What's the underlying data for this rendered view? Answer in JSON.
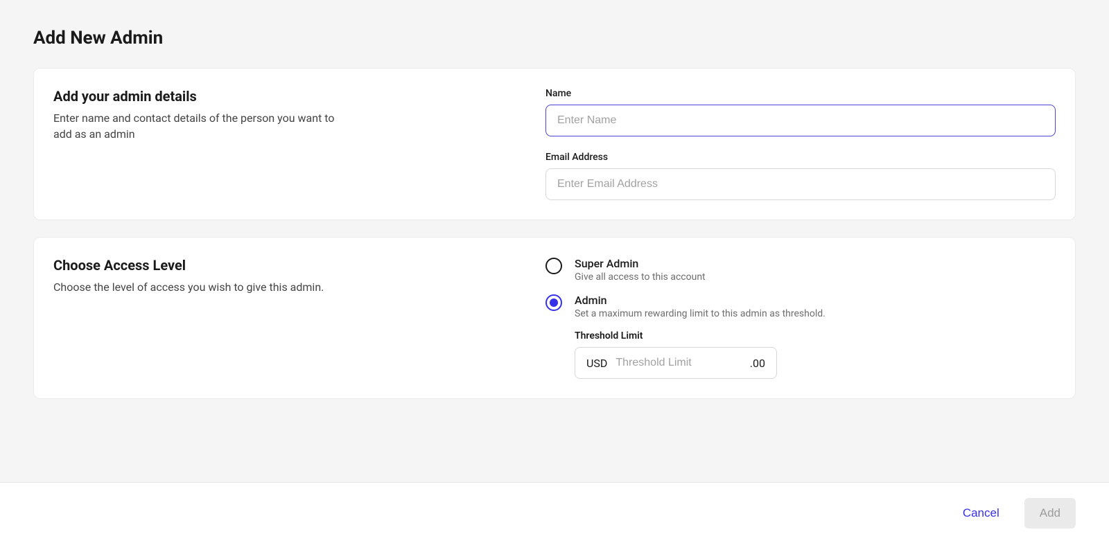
{
  "page": {
    "title": "Add New Admin"
  },
  "details": {
    "heading": "Add your admin details",
    "description": "Enter name and contact details of the person you want to add as an admin",
    "name_label": "Name",
    "name_placeholder": "Enter Name",
    "name_value": "",
    "email_label": "Email Address",
    "email_placeholder": "Enter Email Address",
    "email_value": ""
  },
  "access": {
    "heading": "Choose Access Level",
    "description": "Choose the level of access you wish to give this admin.",
    "options": [
      {
        "title": "Super Admin",
        "desc": "Give all access to this account",
        "selected": false
      },
      {
        "title": "Admin",
        "desc": "Set a maximum rewarding limit to this admin as threshold.",
        "selected": true
      }
    ],
    "threshold": {
      "label": "Threshold Limit",
      "currency": "USD",
      "placeholder": "Threshold Limit",
      "suffix": ".00",
      "value": ""
    }
  },
  "footer": {
    "cancel": "Cancel",
    "add": "Add"
  }
}
